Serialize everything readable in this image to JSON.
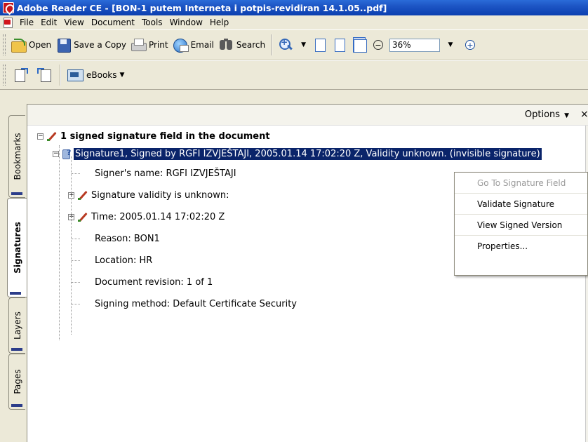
{
  "window": {
    "title": "Adobe Reader CE - [BON-1 putem Interneta i potpis-revidiran 14.1.05..pdf]"
  },
  "menubar": {
    "items": [
      "File",
      "Edit",
      "View",
      "Document",
      "Tools",
      "Window",
      "Help"
    ]
  },
  "toolbar": {
    "open_label": "Open",
    "save_copy_label": "Save a Copy",
    "print_label": "Print",
    "email_label": "Email",
    "search_label": "Search",
    "zoom_value": "36%",
    "ebooks_label": "eBooks"
  },
  "side_tabs": [
    "Bookmarks",
    "Signatures",
    "Layers",
    "Pages"
  ],
  "panel": {
    "options_label": "Options",
    "close_label": "×"
  },
  "tree": {
    "root": "1 signed signature field in the document",
    "signature": "Signature1, Signed by RGFI IZVJEŠTAJI, 2005.01.14 17:02:20 Z, Validity unknown. (invisible signature)",
    "signer_name": "Signer's name: RGFI IZVJEŠTAJI",
    "validity": "Signature validity is unknown:",
    "time": "Time: 2005.01.14 17:02:20 Z",
    "reason": "Reason: BON1",
    "location": "Location: HR",
    "revision": "Document revision: 1 of 1",
    "method": "Signing method: Default Certificate Security"
  },
  "context_menu": {
    "items": [
      "Go To Signature Field",
      "Validate Signature",
      "View Signed Version",
      "Properties..."
    ]
  },
  "colors": {
    "titlebar": "#0b3fb0",
    "chrome": "#ece9d8",
    "selection": "#0a246a"
  }
}
